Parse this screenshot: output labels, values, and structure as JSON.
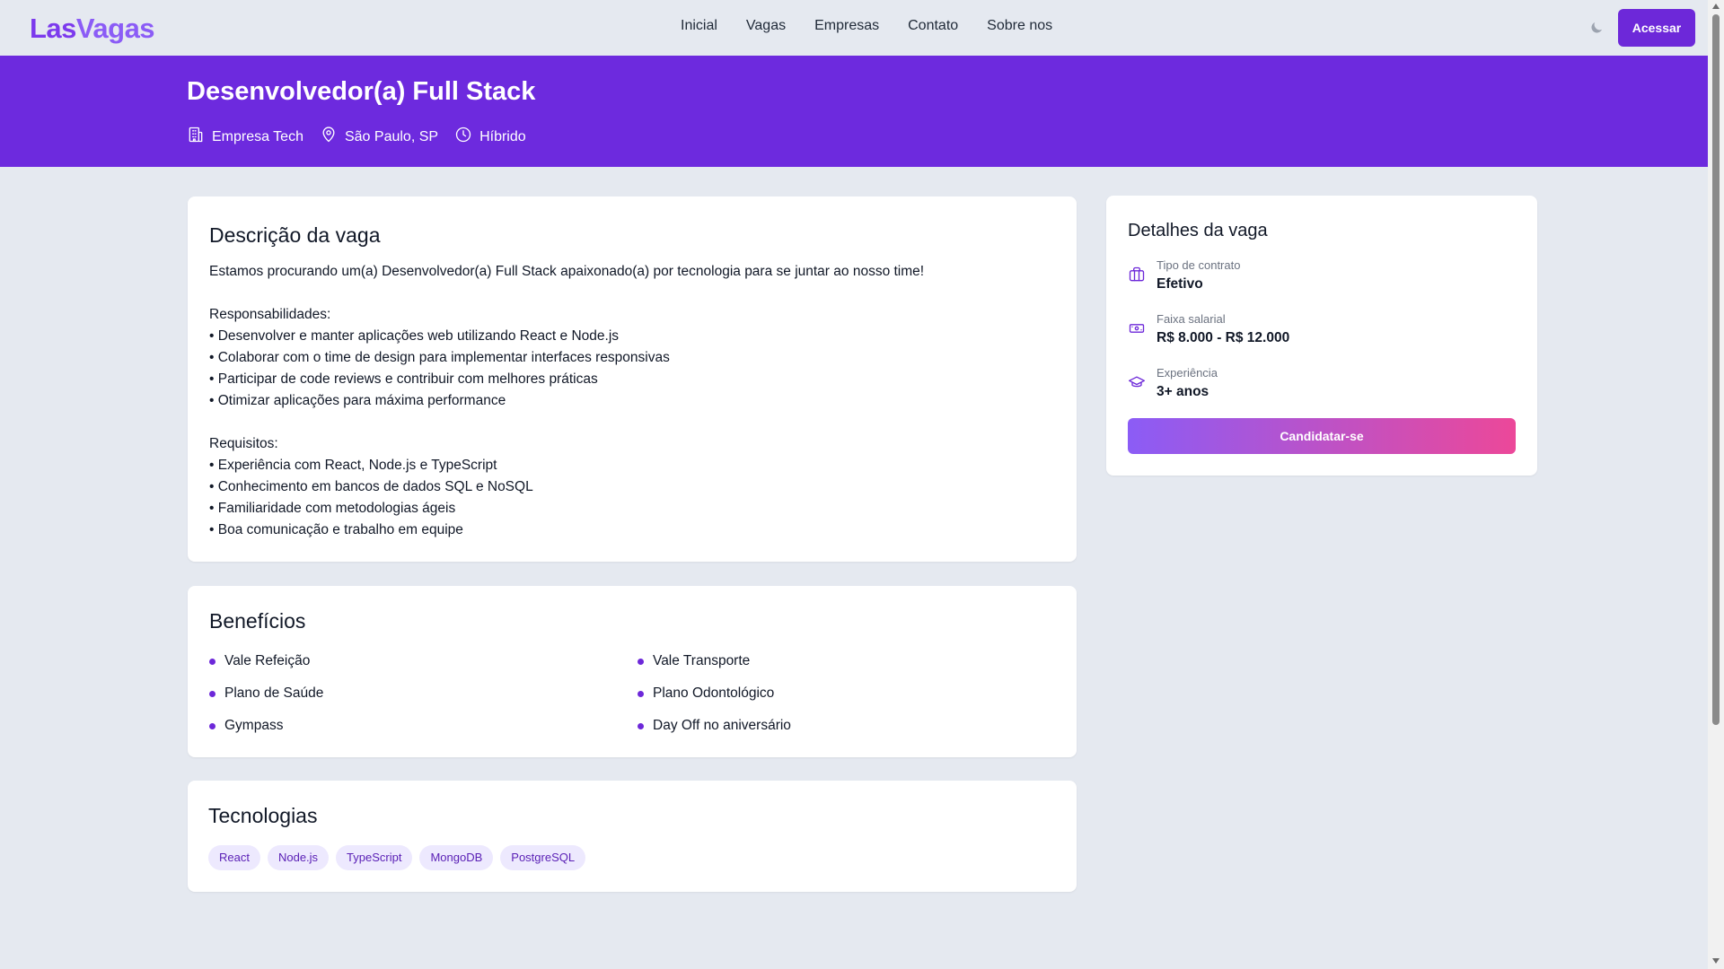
{
  "logo": {
    "part1": "Las",
    "part2": "Vagas"
  },
  "nav": {
    "items": [
      "Inicial",
      "Vagas",
      "Empresas",
      "Contato",
      "Sobre nos"
    ],
    "login_label": "Acessar",
    "theme_icon": "moon-icon"
  },
  "hero": {
    "title": "Desenvolvedor(a) Full Stack",
    "company": "Empresa Tech",
    "location": "São Paulo, SP",
    "mode": "Híbrido"
  },
  "description": {
    "title": "Descrição da vaga",
    "text": "Estamos procurando um(a) Desenvolvedor(a) Full Stack apaixonado(a) por tecnologia para se juntar ao nosso time!\n\nResponsabilidades:\n• Desenvolver e manter aplicações web utilizando React e Node.js\n• Colaborar com o time de design para implementar interfaces responsivas\n• Participar de code reviews e contribuir com melhores práticas\n• Otimizar aplicações para máxima performance\n\nRequisitos:\n• Experiência com React, Node.js e TypeScript\n• Conhecimento em bancos de dados SQL e NoSQL\n• Familiaridade com metodologias ágeis\n• Boa comunicação e trabalho em equipe"
  },
  "benefits": {
    "title": "Benefícios",
    "items": [
      "Vale Refeição",
      "Vale Transporte",
      "Plano de Saúde",
      "Plano Odontológico",
      "Gympass",
      "Day Off no aniversário"
    ]
  },
  "technologies": {
    "title": "Tecnologias",
    "tags": [
      "React",
      "Node.js",
      "TypeScript",
      "MongoDB",
      "PostgreSQL"
    ]
  },
  "details": {
    "title": "Detalhes da vaga",
    "contract_label": "Tipo de contrato",
    "contract_value": "Efetivo",
    "salary_label": "Faixa salarial",
    "salary_value": "R$ 8.000 - R$ 12.000",
    "experience_label": "Experiência",
    "experience_value": "3+ anos",
    "apply_label": "Candidatar-se"
  },
  "colors": {
    "primary": "#6d28d9",
    "hero": "#6d2ade",
    "gradient_start": "#8b5cf6",
    "gradient_end": "#ec4899",
    "background": "#e5e9f0"
  }
}
